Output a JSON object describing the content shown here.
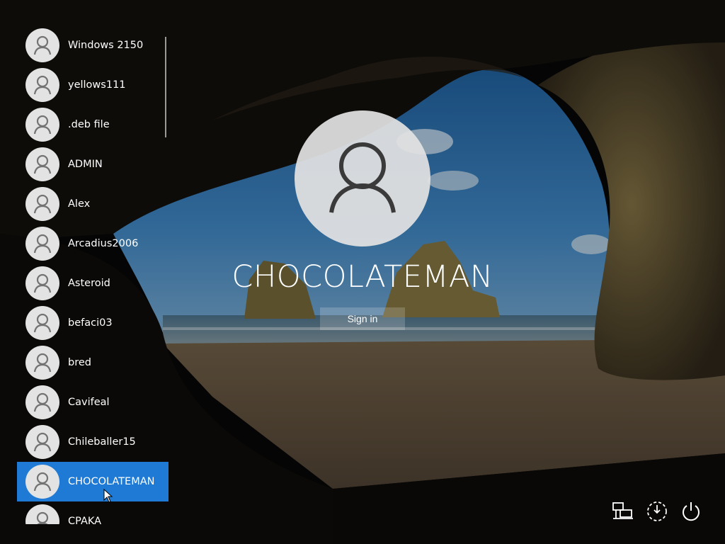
{
  "users": [
    {
      "name": "Windows 2150"
    },
    {
      "name": "yellows111"
    },
    {
      "name": ".deb file"
    },
    {
      "name": "ADMIN"
    },
    {
      "name": "Alex"
    },
    {
      "name": "Arcadius2006"
    },
    {
      "name": "Asteroid"
    },
    {
      "name": "befaci03"
    },
    {
      "name": "bred"
    },
    {
      "name": "Cavifeal"
    },
    {
      "name": "Chileballer15"
    },
    {
      "name": "CHOCOLATEMAN"
    },
    {
      "name": "CPAKA"
    }
  ],
  "selected_user": "CHOCOLATEMAN",
  "signin": {
    "username": "CHOCOLATEMAN",
    "button_label": "Sign in"
  },
  "tray": {
    "network_icon": "network-icon",
    "accessibility_icon": "ease-of-access-icon",
    "power_icon": "power-icon"
  },
  "colors": {
    "selected": "#1e7ad4",
    "avatar": "#e3e3e3",
    "icon_gray": "#737373"
  }
}
